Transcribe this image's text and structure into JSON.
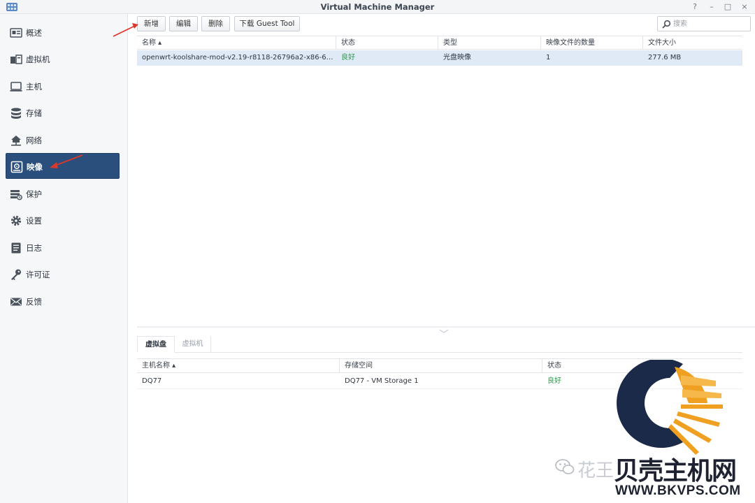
{
  "window": {
    "title": "Virtual Machine Manager",
    "controls": [
      "?",
      "–",
      "□",
      "×"
    ]
  },
  "sidebar": {
    "items": [
      {
        "label": "概述",
        "icon": "overview-icon"
      },
      {
        "label": "虚拟机",
        "icon": "virtual-machine-icon"
      },
      {
        "label": "主机",
        "icon": "host-icon"
      },
      {
        "label": "存储",
        "icon": "storage-icon"
      },
      {
        "label": "网络",
        "icon": "network-icon"
      },
      {
        "label": "映像",
        "icon": "image-icon",
        "active": true
      },
      {
        "label": "保护",
        "icon": "protection-icon"
      },
      {
        "label": "设置",
        "icon": "settings-gear-icon"
      },
      {
        "label": "日志",
        "icon": "log-icon"
      },
      {
        "label": "许可证",
        "icon": "license-key-icon"
      },
      {
        "label": "反馈",
        "icon": "feedback-envelope-icon"
      }
    ]
  },
  "toolbar": {
    "create": "新增",
    "edit": "编辑",
    "delete": "删除",
    "download_guest_tool": "下载 Guest Tool",
    "search_placeholder": "搜索"
  },
  "images_table": {
    "columns": [
      "名称 ▴",
      "状态",
      "类型",
      "映像文件的数量",
      "文件大小"
    ],
    "rows": [
      {
        "name": "openwrt-koolshare-mod-v2.19-r8118-26796a2-x86-64-c...",
        "status": "良好",
        "type": "光盘映像",
        "file_count": "1",
        "size": "277.6 MB"
      }
    ]
  },
  "bottom_tabs": [
    "虚拟盘",
    "虚拟机"
  ],
  "disk_table": {
    "columns": [
      "主机名称 ▴",
      "存储空间",
      "状态"
    ],
    "rows": [
      {
        "host": "DQ77",
        "storage": "DQ77 - VM Storage 1",
        "status": "良好"
      }
    ]
  },
  "watermark": {
    "prefix": "花王",
    "brand": "贝壳主机网",
    "url": "WWW.BKVPS.COM"
  },
  "colors": {
    "accent": "#2b4f7c",
    "selected_row": "#dfeaf6",
    "good_status": "#2a9a4a",
    "annotation_arrow": "#d9392b",
    "logo_navy": "#1c2a4a",
    "logo_orange": "#f0a020"
  }
}
